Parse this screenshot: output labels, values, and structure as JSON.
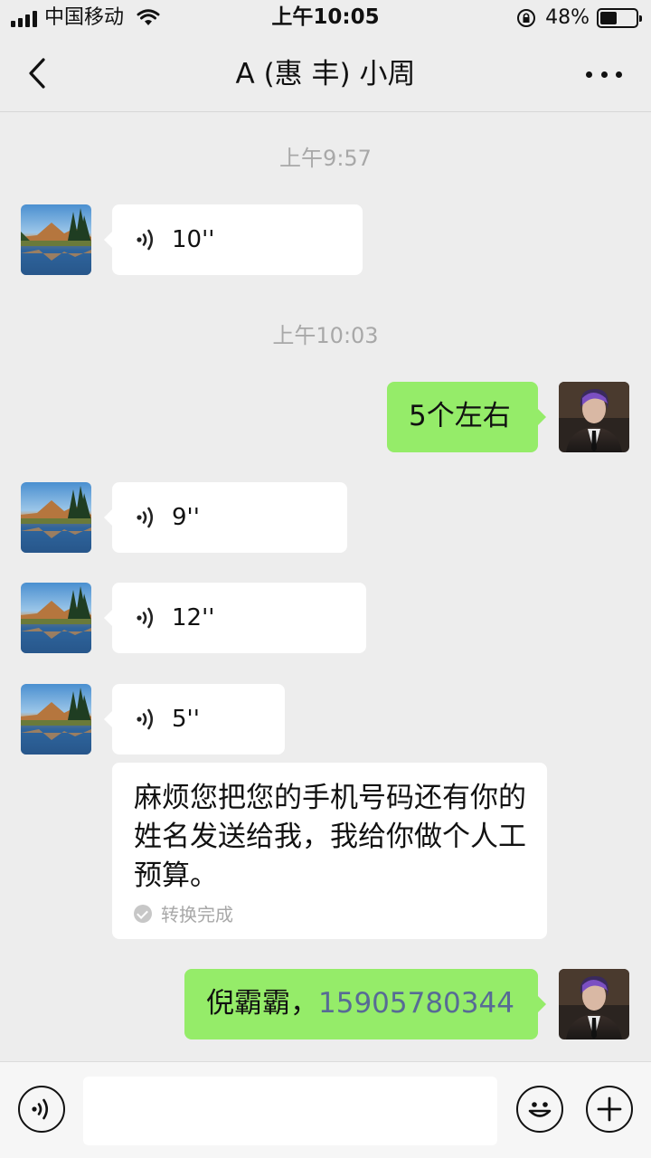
{
  "status_bar": {
    "carrier": "中国移动",
    "time": "上午10:05",
    "battery": "48%",
    "battery_level": 0.48
  },
  "nav": {
    "title": "A (惠 丰) 小周"
  },
  "messages": {
    "ts1": "上午9:57",
    "v1_duration": "10''",
    "ts2": "上午10:03",
    "sent1": "5个左右",
    "v2_duration": "9''",
    "v3_duration": "12''",
    "v4_duration": "5''",
    "transcript": "麻烦您把您的手机号码还有你的姓名发送给我，我给你做个人工预算。",
    "transcript_status": "转换完成",
    "sent2_name": "倪霸霸，",
    "sent2_phone": "15905780344"
  },
  "input": {
    "placeholder": ""
  },
  "colors": {
    "background": "#ededed",
    "sent_bubble": "#95ec69",
    "received_bubble": "#ffffff",
    "link": "#576b95"
  }
}
